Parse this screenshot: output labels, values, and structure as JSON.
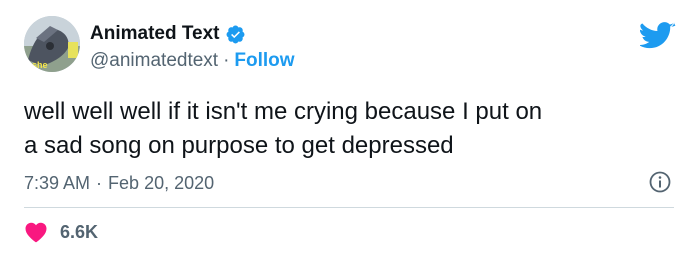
{
  "author": {
    "display_name": "Animated Text",
    "handle": "@animatedtext",
    "separator": "·",
    "follow_label": "Follow",
    "avatar_text": "she"
  },
  "tweet": {
    "text": "well well well if it isn't me crying because I put on\na sad song on purpose to get depressed",
    "time": "7:39 AM",
    "date": "Feb 20, 2020",
    "likes": "6.6K"
  },
  "icons": {
    "verified": "verified-badge-icon",
    "logo": "twitter-bird-icon",
    "info": "info-icon",
    "like": "heart-icon"
  },
  "colors": {
    "accent": "#1d9bf0",
    "like": "#f91880",
    "muted": "#536471",
    "text": "#0f1419"
  }
}
